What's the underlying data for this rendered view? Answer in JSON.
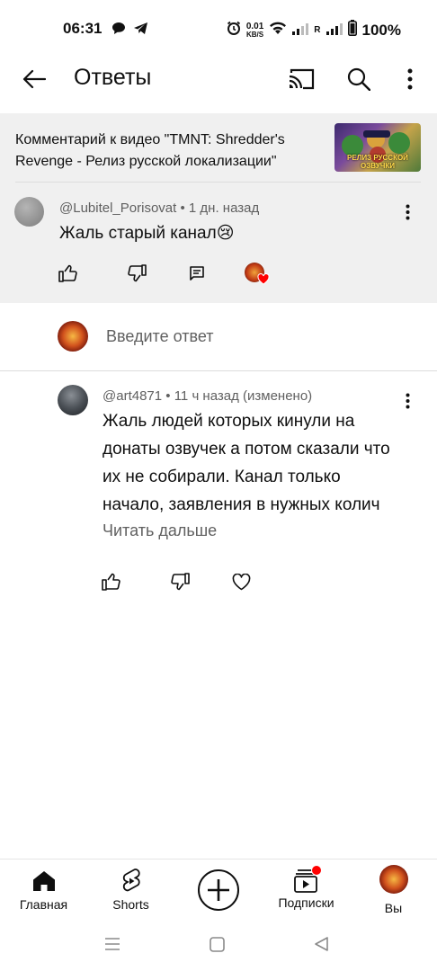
{
  "status_bar": {
    "time": "06:31",
    "net_speed_value": "0.01",
    "net_speed_unit": "KB/S",
    "roaming": "R",
    "battery": "100%"
  },
  "app_bar": {
    "title": "Ответы",
    "back_icon": "arrow-left-icon",
    "cast_icon": "cast-icon",
    "search_icon": "search-icon",
    "more_icon": "more-vert-icon"
  },
  "context": {
    "text": "Комментарий к видео \"TMNT: Shredder's Revenge - Релиз русской локализации\"",
    "thumbnail_caption": "РЕЛИЗ РУССКОЙ ОЗВУЧКИ"
  },
  "parent_comment": {
    "author": "@Lubitel_Porisovat",
    "time": "1 дн. назад",
    "text": "Жаль старый канал😢"
  },
  "reply_input": {
    "placeholder": "Введите ответ"
  },
  "reply": {
    "author": "@art4871",
    "time": "11 ч назад (изменено)",
    "lines": [
      "Жаль людей которых кинули на",
      "донаты озвучек а потом сказали что",
      "их не собирали. Канал только",
      "начало,  заявления в нужных колич"
    ],
    "read_more": "Читать дальше"
  },
  "bottom_nav": {
    "home": "Главная",
    "shorts": "Shorts",
    "subscriptions": "Подписки",
    "you": "Вы"
  },
  "colors": {
    "accent_red": "#ff0000",
    "header_bg": "#f0f0f0",
    "text_primary": "#0f0f0f",
    "text_secondary": "#606060"
  }
}
